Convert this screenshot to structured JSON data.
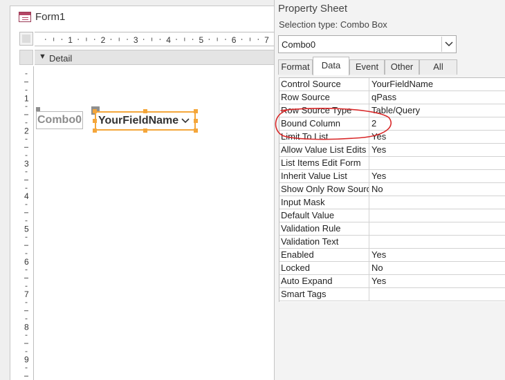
{
  "form": {
    "title": "Form1",
    "section_label": "Detail",
    "ruler_marks_h": [
      "1",
      "2",
      "3",
      "4",
      "5",
      "6",
      "7"
    ],
    "ruler_marks_v": [
      "1",
      "2",
      "3",
      "4",
      "5",
      "6",
      "7",
      "8",
      "9"
    ],
    "label_control_text": "Combo0",
    "combo_control_text": "YourFieldName",
    "selection_color": "#f4a63a"
  },
  "property_sheet": {
    "title": "Property Sheet",
    "selection_type_label": "Selection type:  Combo Box",
    "object_selector_value": "Combo0",
    "tabs": [
      {
        "label": "Format",
        "active": false
      },
      {
        "label": "Data",
        "active": true
      },
      {
        "label": "Event",
        "active": false
      },
      {
        "label": "Other",
        "active": false
      },
      {
        "label": "All",
        "active": false
      }
    ],
    "properties": [
      {
        "name": "Control Source",
        "value": "YourFieldName"
      },
      {
        "name": "Row Source",
        "value": "qPass"
      },
      {
        "name": "Row Source Type",
        "value": "Table/Query"
      },
      {
        "name": "Bound Column",
        "value": "2"
      },
      {
        "name": "Limit To List",
        "value": "Yes"
      },
      {
        "name": "Allow Value List Edits",
        "value": "Yes"
      },
      {
        "name": "List Items Edit Form",
        "value": ""
      },
      {
        "name": "Inherit Value List",
        "value": "Yes"
      },
      {
        "name": "Show Only Row Source Values",
        "value": "No"
      },
      {
        "name": "Input Mask",
        "value": ""
      },
      {
        "name": "Default Value",
        "value": ""
      },
      {
        "name": "Validation Rule",
        "value": ""
      },
      {
        "name": "Validation Text",
        "value": ""
      },
      {
        "name": "Enabled",
        "value": "Yes"
      },
      {
        "name": "Locked",
        "value": "No"
      },
      {
        "name": "Auto Expand",
        "value": "Yes"
      },
      {
        "name": "Smart Tags",
        "value": ""
      }
    ],
    "annotation_color": "#d9292a"
  }
}
